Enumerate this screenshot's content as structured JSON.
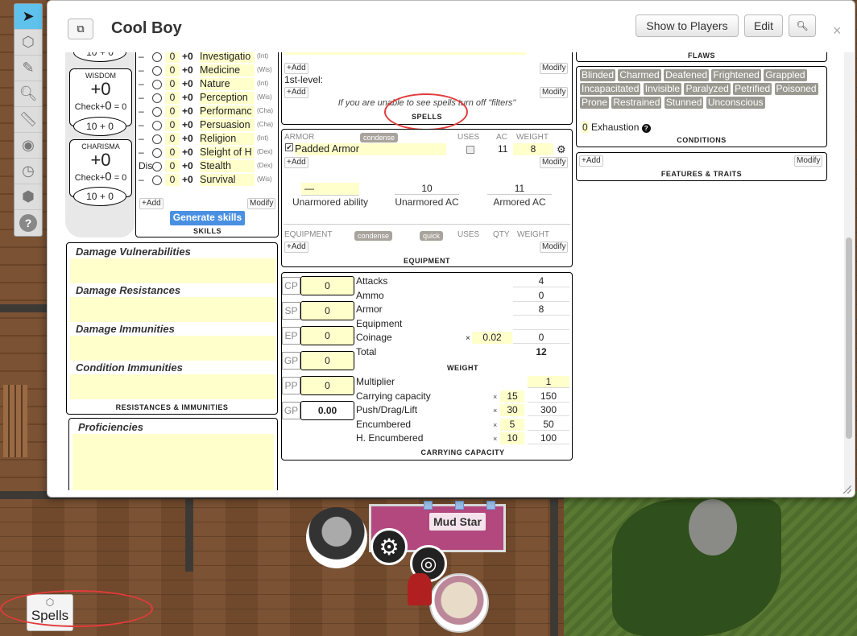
{
  "dialog": {
    "title": "Cool Boy",
    "show_to_players": "Show to Players",
    "edit": "Edit",
    "close": "×"
  },
  "abilities": [
    {
      "name": "WISDOM",
      "mod": "+0",
      "check_label": "Check+",
      "check_val": "0",
      "eq": "= 0",
      "oval_a": "10",
      "plus": "+",
      "oval_b": "0"
    },
    {
      "name": "CHARISMA",
      "mod": "+0",
      "check_label": "Check+",
      "check_val": "0",
      "eq": "= 0",
      "oval_a": "10",
      "plus": "+",
      "oval_b": "0"
    }
  ],
  "ability_top_oval": {
    "a": "10",
    "plus": "+",
    "b": "0"
  },
  "skills": {
    "rows": [
      {
        "dash": "–",
        "prof": "0",
        "bonus": "+0",
        "name": "Investigatio",
        "abil": "(Int)"
      },
      {
        "dash": "–",
        "prof": "0",
        "bonus": "+0",
        "name": "Medicine",
        "abil": "(Wis)"
      },
      {
        "dash": "–",
        "prof": "0",
        "bonus": "+0",
        "name": "Nature",
        "abil": "(Int)"
      },
      {
        "dash": "–",
        "prof": "0",
        "bonus": "+0",
        "name": "Perception",
        "abil": "(Wis)"
      },
      {
        "dash": "–",
        "prof": "0",
        "bonus": "+0",
        "name": "Performanc",
        "abil": "(Cha)"
      },
      {
        "dash": "–",
        "prof": "0",
        "bonus": "+0",
        "name": "Persuasion",
        "abil": "(Cha)"
      },
      {
        "dash": "–",
        "prof": "0",
        "bonus": "+0",
        "name": "Religion",
        "abil": "(Int)"
      },
      {
        "dash": "–",
        "prof": "0",
        "bonus": "+0",
        "name": "Sleight of H",
        "abil": "(Dex)"
      },
      {
        "dash": "Dis",
        "prof": "0",
        "bonus": "+0",
        "name": "Stealth",
        "abil": "(Dex)"
      },
      {
        "dash": "–",
        "prof": "0",
        "bonus": "+0",
        "name": "Survival",
        "abil": "(Wis)"
      }
    ],
    "add": "+Add",
    "modify": "Modify",
    "generate": "Generate skills",
    "caption": "SKILLS"
  },
  "resistances": {
    "vulnerabilities": "Damage Vulnerabilities",
    "resistances": "Damage Resistances",
    "immunities": "Damage Immunities",
    "condition_immunities": "Condition Immunities",
    "caption": "RESISTANCES & IMMUNITIES"
  },
  "proficiencies": {
    "label": "Proficiencies"
  },
  "spells": {
    "add1": "+Add",
    "modify1": "Modify",
    "level": "1st-level:",
    "add2": "+Add",
    "modify2": "Modify",
    "note": "If you are unable to see spells turn off \"filters\"",
    "caption": "SPELLS"
  },
  "armor": {
    "header": "ARMOR",
    "condense": "condense",
    "uses": "USES",
    "ac": "AC",
    "weight": "WEIGHT",
    "item_name": "Padded Armor",
    "item_ac": "11",
    "item_weight": "8",
    "add": "+Add",
    "modify": "Modify",
    "unarmored_ability_value": "—",
    "unarmored_ability_label": "Unarmored ability",
    "unarmored_ac_value": "10",
    "unarmored_ac_label": "Unarmored AC",
    "armored_ac_value": "11",
    "armored_ac_label": "Armored AC"
  },
  "equipment": {
    "header": "EQUIPMENT",
    "condense": "condense",
    "quick": "quick",
    "uses": "USES",
    "qty": "QTY",
    "weight": "WEIGHT",
    "add": "+Add",
    "modify": "Modify",
    "caption": "EQUIPMENT"
  },
  "coins": [
    {
      "label": "CP",
      "value": "0"
    },
    {
      "label": "SP",
      "value": "0"
    },
    {
      "label": "EP",
      "value": "0"
    },
    {
      "label": "GP",
      "value": "0"
    },
    {
      "label": "PP",
      "value": "0"
    },
    {
      "label": "GP",
      "value": "0.00"
    }
  ],
  "weight": {
    "rows": [
      {
        "label": "Attacks",
        "value": "4"
      },
      {
        "label": "Ammo",
        "value": "0"
      },
      {
        "label": "Armor",
        "value": "8"
      },
      {
        "label": "Equipment",
        "value": ""
      },
      {
        "label": "Coinage",
        "value": "0"
      },
      {
        "label": "Total",
        "value": "12"
      }
    ],
    "coin_mult_sign": "×",
    "coin_mult": "0.02",
    "caption": "WEIGHT"
  },
  "capacity": {
    "rows": [
      {
        "label": "Multiplier",
        "mult": "",
        "value": "1"
      },
      {
        "label": "Carrying capacity",
        "mult": "15",
        "value": "150"
      },
      {
        "label": "Push/Drag/Lift",
        "mult": "30",
        "value": "300"
      },
      {
        "label": "Encumbered",
        "mult": "5",
        "value": "50"
      },
      {
        "label": "H. Encumbered",
        "mult": "10",
        "value": "100"
      }
    ],
    "sign": "×",
    "caption": "CARRYING CAPACITY"
  },
  "flaws": {
    "caption": "FLAWS"
  },
  "conditions": {
    "tags": [
      "Blinded",
      "Charmed",
      "Deafened",
      "Frightened",
      "Grappled",
      "Incapacitated",
      "Invisible",
      "Paralyzed",
      "Petrified",
      "Poisoned",
      "Prone",
      "Restrained",
      "Stunned",
      "Unconscious"
    ],
    "exhaustion_value": "0",
    "exhaustion_label": "Exhaustion",
    "caption": "CONDITIONS"
  },
  "features": {
    "add": "+Add",
    "modify": "Modify",
    "caption": "FEATURES & TRAITS"
  },
  "map": {
    "token_name": "Mud Star",
    "macro_label": "Spells"
  },
  "colors": {
    "highlight": "#ffffcc",
    "accent": "#4a90e2",
    "toolbar_active": "#5ec2ec",
    "annotation": "#e23b3b"
  }
}
